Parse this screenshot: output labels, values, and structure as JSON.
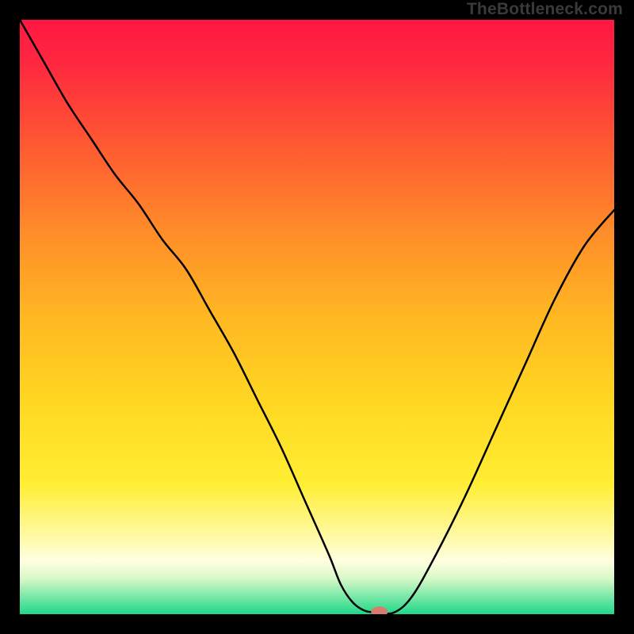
{
  "watermark": "TheBottleneck.com",
  "chart_data": {
    "type": "line",
    "title": "",
    "xlabel": "",
    "ylabel": "",
    "xlim": [
      0,
      100
    ],
    "ylim": [
      0,
      100
    ],
    "legend": false,
    "grid": false,
    "background_gradient": {
      "stops": [
        {
          "offset": 0.0,
          "color": "#ff1744"
        },
        {
          "offset": 0.08,
          "color": "#ff2a3f"
        },
        {
          "offset": 0.2,
          "color": "#ff5533"
        },
        {
          "offset": 0.35,
          "color": "#ff8a2a"
        },
        {
          "offset": 0.5,
          "color": "#ffb822"
        },
        {
          "offset": 0.65,
          "color": "#ffd822"
        },
        {
          "offset": 0.78,
          "color": "#ffee33"
        },
        {
          "offset": 0.86,
          "color": "#fff899"
        },
        {
          "offset": 0.91,
          "color": "#ffffe0"
        },
        {
          "offset": 0.94,
          "color": "#d8f8c8"
        },
        {
          "offset": 0.97,
          "color": "#7be8a8"
        },
        {
          "offset": 1.0,
          "color": "#1fd88a"
        }
      ]
    },
    "series": [
      {
        "name": "bottleneck-curve",
        "color": "#000000",
        "width": 2.5,
        "x": [
          0,
          4,
          8,
          12,
          16,
          20,
          24,
          28,
          32,
          36,
          40,
          44,
          48,
          52,
          54,
          56,
          58,
          60,
          63,
          66,
          70,
          75,
          80,
          85,
          90,
          95,
          100
        ],
        "y": [
          100,
          93,
          86,
          80,
          74,
          69,
          63,
          58,
          51,
          44,
          36,
          28,
          19,
          10,
          5,
          2,
          0.6,
          0.3,
          0.3,
          3,
          10,
          20,
          31,
          42,
          53,
          62,
          68
        ]
      }
    ],
    "marker": {
      "name": "optimum-marker",
      "x": 60.5,
      "y": 0.4,
      "rx": 1.4,
      "ry": 0.9,
      "color": "#d97a6e"
    }
  }
}
